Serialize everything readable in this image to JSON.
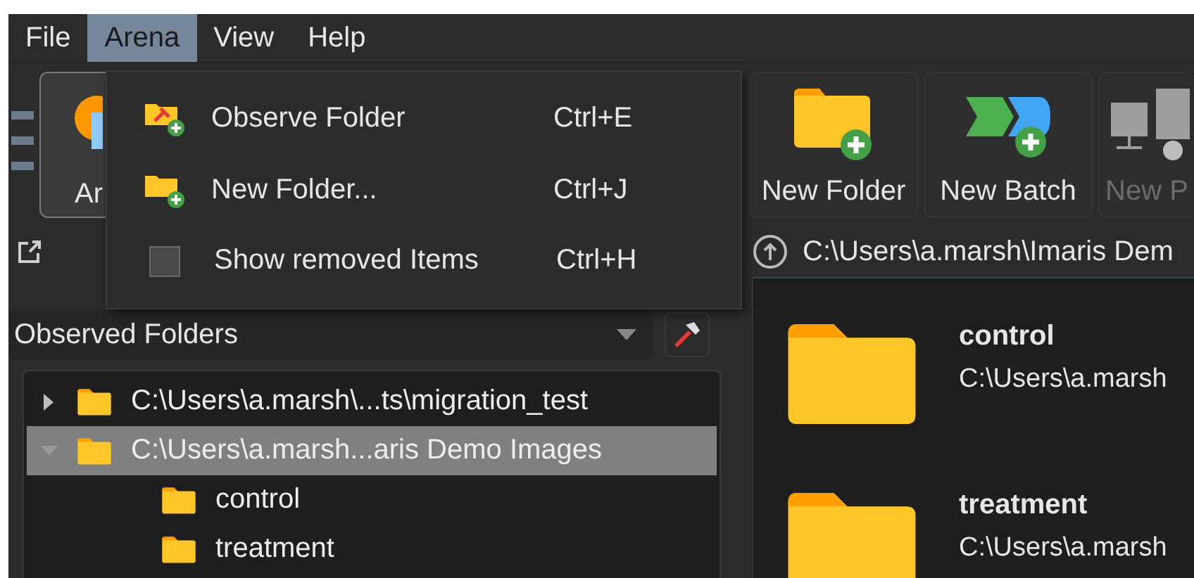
{
  "menu_bar": [
    {
      "label": "File",
      "selected": false
    },
    {
      "label": "Arena",
      "selected": true
    },
    {
      "label": "View",
      "selected": false
    },
    {
      "label": "Help",
      "selected": false
    }
  ],
  "toolbar": {
    "left_button": {
      "label": "Ar"
    },
    "buttons": [
      {
        "label": "New Folder",
        "kind": "folder",
        "disabled": false
      },
      {
        "label": "New Batch",
        "kind": "batch",
        "disabled": false
      },
      {
        "label": "New P",
        "kind": "pipeline",
        "disabled": true
      }
    ]
  },
  "path_bar": {
    "path": "C:\\Users\\a.marsh\\Imaris Dem"
  },
  "folder_selector": {
    "value": "Observed Folders"
  },
  "tree": [
    {
      "label": "C:\\Users\\a.marsh\\...ts\\migration_test",
      "expanded": false,
      "selected": false
    },
    {
      "label": "C:\\Users\\a.marsh...aris Demo Images",
      "expanded": true,
      "selected": true,
      "children": [
        {
          "label": "control"
        },
        {
          "label": "treatment"
        }
      ]
    }
  ],
  "content_items": [
    {
      "name": "control",
      "path": "C:\\Users\\a.marsh"
    },
    {
      "name": "treatment",
      "path": "C:\\Users\\a.marsh"
    }
  ],
  "arena_menu": [
    {
      "label": "Observe Folder",
      "shortcut": "Ctrl+E",
      "kind": "observe"
    },
    {
      "label": "New Folder...",
      "shortcut": "Ctrl+J",
      "kind": "folder"
    },
    {
      "label": "Show removed Items",
      "shortcut": "Ctrl+H",
      "kind": "check",
      "checked": false
    }
  ]
}
